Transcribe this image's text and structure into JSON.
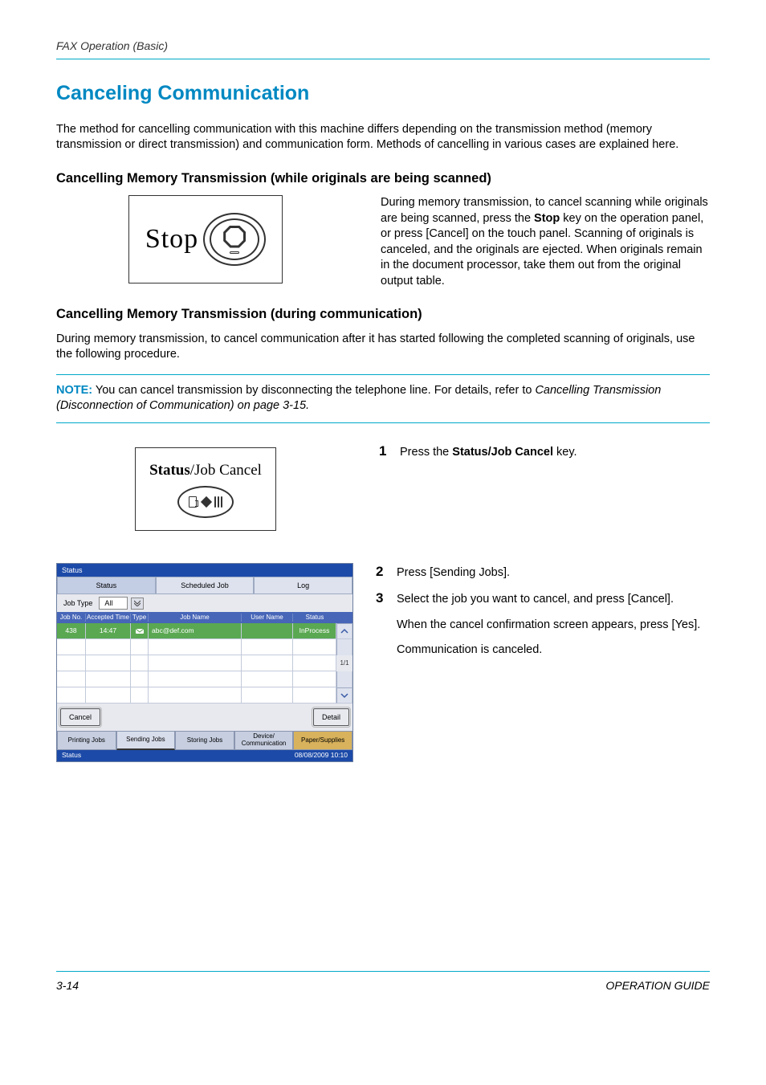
{
  "header": {
    "running": "FAX Operation (Basic)"
  },
  "title": "Canceling Communication",
  "intro": "The method for cancelling communication with this machine differs depending on the transmission method (memory transmission or direct transmission) and communication form. Methods of cancelling in various cases are explained here.",
  "sec1": {
    "heading": "Cancelling Memory Transmission (while originals are being scanned)",
    "stop_label": "Stop",
    "body_pre": "During memory transmission, to cancel scanning while originals are being scanned, press the ",
    "body_bold": "Stop",
    "body_post": " key on the operation panel, or press [Cancel] on the touch panel. Scanning of originals is canceled, and the originals are ejected. When originals remain in the document processor, take them out from the original output table."
  },
  "sec2": {
    "heading": "Cancelling Memory Transmission (during communication)",
    "intro": "During memory transmission, to cancel communication after it has started following the completed scanning of originals, use the following procedure.",
    "note_label": "NOTE:",
    "note_text": " You can cancel transmission by disconnecting the telephone line. For details, refer to ",
    "note_ref": "Cancelling Transmission (Disconnection of Communication) on page 3-15."
  },
  "steps": {
    "s1_num": "1",
    "s1_pre": "Press the ",
    "s1_bold": "Status/Job Cancel",
    "s1_post": " key.",
    "s2_num": "2",
    "s2_text": "Press [Sending Jobs].",
    "s3_num": "3",
    "s3_text": "Select the job you want to cancel, and press [Cancel].",
    "s3_a": "When the cancel confirmation screen appears, press [Yes].",
    "s3_b": "Communication is canceled."
  },
  "sjc_key": {
    "bold": "Status",
    "rest": "/Job Cancel"
  },
  "panel": {
    "titlebar": "Status",
    "tabs": {
      "status": "Status",
      "scheduled": "Scheduled Job",
      "log": "Log"
    },
    "filter_label": "Job Type",
    "filter_value": "All",
    "headers": {
      "no": "Job No.",
      "time": "Accepted Time",
      "type": "Type",
      "name": "Job Name",
      "user": "User Name",
      "status": "Status"
    },
    "row": {
      "no": "438",
      "time": "14:47",
      "name": "abc@def.com",
      "user": "",
      "status": "InProcess"
    },
    "pagecount": "1/1",
    "cancel_btn": "Cancel",
    "detail_btn": "Detail",
    "bottom_tabs": {
      "printing": "Printing Jobs",
      "sending": "Sending Jobs",
      "storing": "Storing Jobs",
      "device": "Device/\nCommunication",
      "supplies": "Paper/Supplies"
    },
    "footer_left": "Status",
    "footer_right": "08/08/2009   10:10"
  },
  "footer": {
    "page": "3-14",
    "guide": "OPERATION GUIDE"
  }
}
